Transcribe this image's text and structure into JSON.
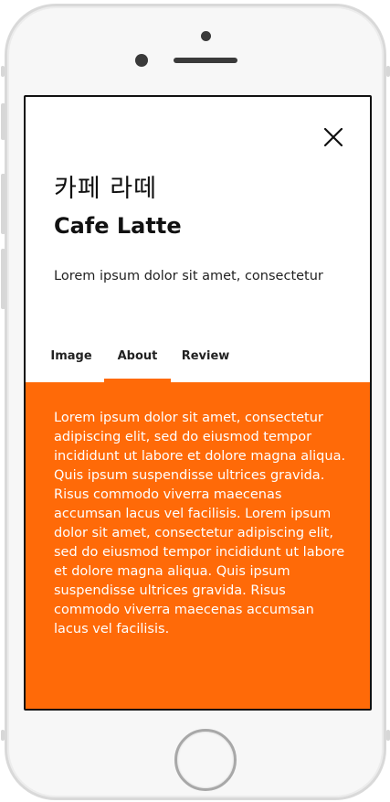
{
  "product": {
    "title_ko": "카페 라떼",
    "title_en": "Cafe Latte",
    "subtitle": "Lorem ipsum dolor sit amet, consectetur"
  },
  "tabs": [
    {
      "label": "Image",
      "active": false
    },
    {
      "label": "About",
      "active": true
    },
    {
      "label": "Review",
      "active": false
    }
  ],
  "content": {
    "body": "Lorem ipsum dolor sit amet, consectetur adipiscing elit, sed do eiusmod tempor incididunt ut labore et dolore magna aliqua. Quis ipsum suspendisse ultrices gravida. Risus commodo viverra maecenas accumsan lacus vel facilisis. Lorem ipsum dolor sit amet, consectetur adipiscing elit, sed do eiusmod tempor incididunt ut labore et dolore magna aliqua. Quis ipsum suspendisse ultrices gravida. Risus commodo viverra maecenas accumsan lacus vel facilisis."
  },
  "icons": {
    "close": "close-icon"
  },
  "colors": {
    "accent": "#ff6a08",
    "text": "#111111",
    "content_text": "#ffffff"
  }
}
